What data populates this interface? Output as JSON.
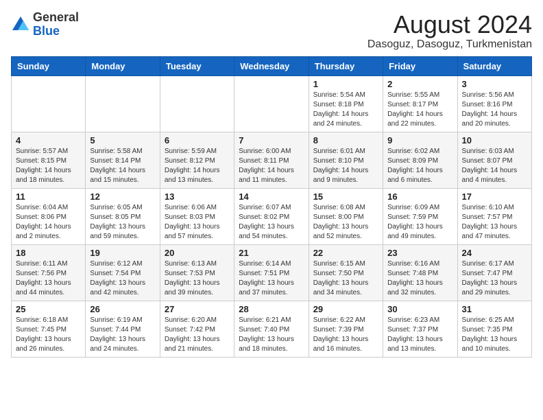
{
  "header": {
    "logo": {
      "line1": "General",
      "line2": "Blue"
    },
    "title": "August 2024",
    "location": "Dasoguz, Dasoguz, Turkmenistan"
  },
  "weekdays": [
    "Sunday",
    "Monday",
    "Tuesday",
    "Wednesday",
    "Thursday",
    "Friday",
    "Saturday"
  ],
  "weeks": [
    [
      {
        "day": "",
        "info": ""
      },
      {
        "day": "",
        "info": ""
      },
      {
        "day": "",
        "info": ""
      },
      {
        "day": "",
        "info": ""
      },
      {
        "day": "1",
        "info": "Sunrise: 5:54 AM\nSunset: 8:18 PM\nDaylight: 14 hours\nand 24 minutes."
      },
      {
        "day": "2",
        "info": "Sunrise: 5:55 AM\nSunset: 8:17 PM\nDaylight: 14 hours\nand 22 minutes."
      },
      {
        "day": "3",
        "info": "Sunrise: 5:56 AM\nSunset: 8:16 PM\nDaylight: 14 hours\nand 20 minutes."
      }
    ],
    [
      {
        "day": "4",
        "info": "Sunrise: 5:57 AM\nSunset: 8:15 PM\nDaylight: 14 hours\nand 18 minutes."
      },
      {
        "day": "5",
        "info": "Sunrise: 5:58 AM\nSunset: 8:14 PM\nDaylight: 14 hours\nand 15 minutes."
      },
      {
        "day": "6",
        "info": "Sunrise: 5:59 AM\nSunset: 8:12 PM\nDaylight: 14 hours\nand 13 minutes."
      },
      {
        "day": "7",
        "info": "Sunrise: 6:00 AM\nSunset: 8:11 PM\nDaylight: 14 hours\nand 11 minutes."
      },
      {
        "day": "8",
        "info": "Sunrise: 6:01 AM\nSunset: 8:10 PM\nDaylight: 14 hours\nand 9 minutes."
      },
      {
        "day": "9",
        "info": "Sunrise: 6:02 AM\nSunset: 8:09 PM\nDaylight: 14 hours\nand 6 minutes."
      },
      {
        "day": "10",
        "info": "Sunrise: 6:03 AM\nSunset: 8:07 PM\nDaylight: 14 hours\nand 4 minutes."
      }
    ],
    [
      {
        "day": "11",
        "info": "Sunrise: 6:04 AM\nSunset: 8:06 PM\nDaylight: 14 hours\nand 2 minutes."
      },
      {
        "day": "12",
        "info": "Sunrise: 6:05 AM\nSunset: 8:05 PM\nDaylight: 13 hours\nand 59 minutes."
      },
      {
        "day": "13",
        "info": "Sunrise: 6:06 AM\nSunset: 8:03 PM\nDaylight: 13 hours\nand 57 minutes."
      },
      {
        "day": "14",
        "info": "Sunrise: 6:07 AM\nSunset: 8:02 PM\nDaylight: 13 hours\nand 54 minutes."
      },
      {
        "day": "15",
        "info": "Sunrise: 6:08 AM\nSunset: 8:00 PM\nDaylight: 13 hours\nand 52 minutes."
      },
      {
        "day": "16",
        "info": "Sunrise: 6:09 AM\nSunset: 7:59 PM\nDaylight: 13 hours\nand 49 minutes."
      },
      {
        "day": "17",
        "info": "Sunrise: 6:10 AM\nSunset: 7:57 PM\nDaylight: 13 hours\nand 47 minutes."
      }
    ],
    [
      {
        "day": "18",
        "info": "Sunrise: 6:11 AM\nSunset: 7:56 PM\nDaylight: 13 hours\nand 44 minutes."
      },
      {
        "day": "19",
        "info": "Sunrise: 6:12 AM\nSunset: 7:54 PM\nDaylight: 13 hours\nand 42 minutes."
      },
      {
        "day": "20",
        "info": "Sunrise: 6:13 AM\nSunset: 7:53 PM\nDaylight: 13 hours\nand 39 minutes."
      },
      {
        "day": "21",
        "info": "Sunrise: 6:14 AM\nSunset: 7:51 PM\nDaylight: 13 hours\nand 37 minutes."
      },
      {
        "day": "22",
        "info": "Sunrise: 6:15 AM\nSunset: 7:50 PM\nDaylight: 13 hours\nand 34 minutes."
      },
      {
        "day": "23",
        "info": "Sunrise: 6:16 AM\nSunset: 7:48 PM\nDaylight: 13 hours\nand 32 minutes."
      },
      {
        "day": "24",
        "info": "Sunrise: 6:17 AM\nSunset: 7:47 PM\nDaylight: 13 hours\nand 29 minutes."
      }
    ],
    [
      {
        "day": "25",
        "info": "Sunrise: 6:18 AM\nSunset: 7:45 PM\nDaylight: 13 hours\nand 26 minutes."
      },
      {
        "day": "26",
        "info": "Sunrise: 6:19 AM\nSunset: 7:44 PM\nDaylight: 13 hours\nand 24 minutes."
      },
      {
        "day": "27",
        "info": "Sunrise: 6:20 AM\nSunset: 7:42 PM\nDaylight: 13 hours\nand 21 minutes."
      },
      {
        "day": "28",
        "info": "Sunrise: 6:21 AM\nSunset: 7:40 PM\nDaylight: 13 hours\nand 18 minutes."
      },
      {
        "day": "29",
        "info": "Sunrise: 6:22 AM\nSunset: 7:39 PM\nDaylight: 13 hours\nand 16 minutes."
      },
      {
        "day": "30",
        "info": "Sunrise: 6:23 AM\nSunset: 7:37 PM\nDaylight: 13 hours\nand 13 minutes."
      },
      {
        "day": "31",
        "info": "Sunrise: 6:25 AM\nSunset: 7:35 PM\nDaylight: 13 hours\nand 10 minutes."
      }
    ]
  ]
}
